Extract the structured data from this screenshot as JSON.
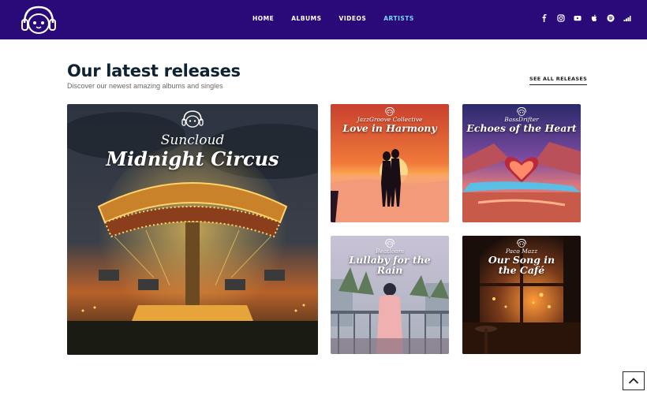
{
  "nav": {
    "items": [
      {
        "label": "HOME",
        "active": false
      },
      {
        "label": "ALBUMS",
        "active": false
      },
      {
        "label": "VIDEOS",
        "active": false
      },
      {
        "label": "ARTISTS",
        "active": true
      }
    ]
  },
  "social_icons": [
    "facebook-icon",
    "instagram-icon",
    "youtube-icon",
    "apple-icon",
    "spotify-icon",
    "deezer-icon"
  ],
  "section": {
    "title": "Our latest releases",
    "subtitle": "Discover our newest amazing albums and singles",
    "see_all_label": "SEE ALL RELEASES"
  },
  "releases": [
    {
      "artist": "Suncloud",
      "title": "Midnight Circus"
    },
    {
      "artist": "JazzGroove Collective",
      "title": "Love in Harmony"
    },
    {
      "artist": "BassDrifter",
      "title": "Echoes of the Heart"
    },
    {
      "artist": "Beatloom",
      "title": "Lullaby for the Rain"
    },
    {
      "artist": "Paco Mazz",
      "title": "Our Song in the Café"
    }
  ],
  "colors": {
    "header_bg": "#2a0a78",
    "nav_active": "#7fd4ff",
    "heading": "#0f2233"
  }
}
